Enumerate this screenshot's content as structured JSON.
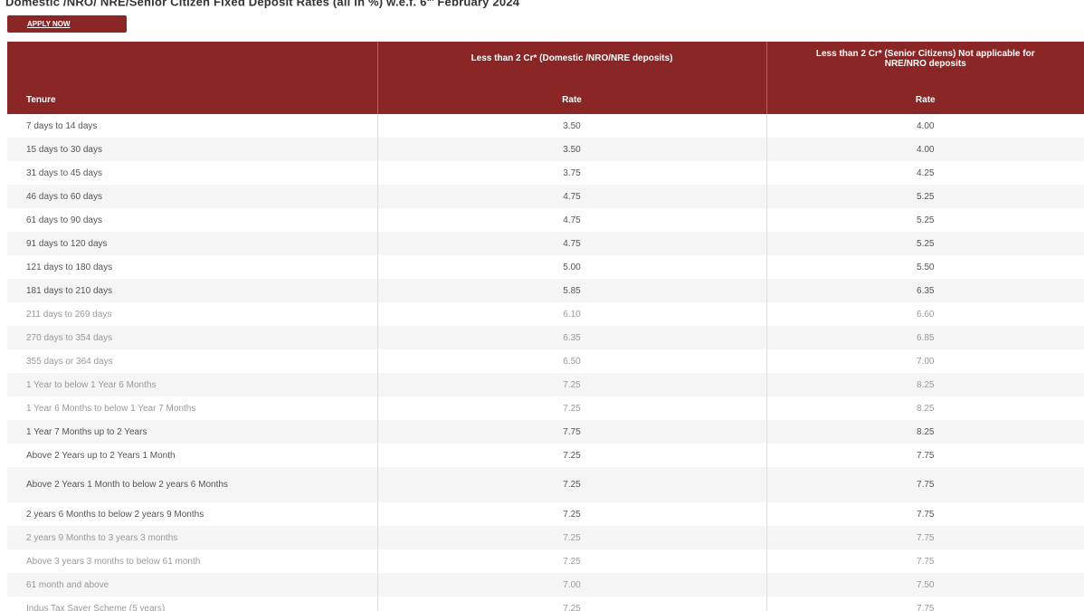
{
  "heading": {
    "prefix": "Domestic /NRO/ NRE/Senior Citizen Fixed Deposit Rates (all in %) w.e.f. 6",
    "sup": "th",
    "suffix": " February 2024"
  },
  "apply_button": {
    "label": "APPLY NOW"
  },
  "table": {
    "headers": {
      "tenure": "Tenure",
      "domestic_title": "Less than 2 Cr* (Domestic /NRO/NRE deposits)",
      "domestic_rate": "Rate",
      "senior_title": "Less than 2 Cr* (Senior Citizens) Not applicable for NRE/NRO deposits",
      "senior_rate": "Rate"
    },
    "rows": [
      {
        "tenure": "7 days to 14 days",
        "domestic": "3.50",
        "senior": "4.00"
      },
      {
        "tenure": "15 days to 30 days",
        "domestic": "3.50",
        "senior": "4.00"
      },
      {
        "tenure": "31 days to 45 days",
        "domestic": "3.75",
        "senior": "4.25"
      },
      {
        "tenure": "46 days to 60 days",
        "domestic": "4.75",
        "senior": "5.25"
      },
      {
        "tenure": "61 days to 90 days",
        "domestic": "4.75",
        "senior": "5.25"
      },
      {
        "tenure": "91 days to 120 days",
        "domestic": "4.75",
        "senior": "5.25"
      },
      {
        "tenure": "121 days to 180 days",
        "domestic": "5.00",
        "senior": "5.50"
      },
      {
        "tenure": "181 days to 210 days",
        "domestic": "5.85",
        "senior": "6.35"
      },
      {
        "tenure": "211 days to 269 days",
        "domestic": "6.10",
        "senior": "6.60"
      },
      {
        "tenure": "270 days to 354 days",
        "domestic": "6.35",
        "senior": "6.85"
      },
      {
        "tenure": "355 days or 364 days",
        "domestic": "6.50",
        "senior": "7.00"
      },
      {
        "tenure": "1 Year to below 1 Year 6 Months",
        "domestic": "7.25",
        "senior": "8.25"
      },
      {
        "tenure": "1 Year 6 Months to below 1 Year 7 Months",
        "domestic": "7.25",
        "senior": "8.25"
      },
      {
        "tenure": "1 Year 7 Months up to 2 Years",
        "domestic": "7.75",
        "senior": "8.25"
      },
      {
        "tenure": "Above 2 Years up to 2 Years 1 Month",
        "domestic": "7.25",
        "senior": "7.75"
      },
      {
        "tenure": "Above 2 Years 1 Month to below 2 years 6 Months",
        "domestic": "7.25",
        "senior": "7.75"
      },
      {
        "tenure": "2 years 6 Months to below 2 years 9 Months",
        "domestic": "7.25",
        "senior": "7.75"
      },
      {
        "tenure": "2 years 9 Months to 3 years 3 months",
        "domestic": "7.25",
        "senior": "7.75"
      },
      {
        "tenure": "Above 3 years 3 months to below 61 month",
        "domestic": "7.25",
        "senior": "7.75"
      },
      {
        "tenure": "61 month and above",
        "domestic": "7.00",
        "senior": "7.50"
      },
      {
        "tenure": "Indus Tax Saver Scheme (5 years)",
        "domestic": "7.25",
        "senior": "7.75"
      }
    ]
  },
  "colors": {
    "header_bg": "#8b2626",
    "row_stripe": "#f5f5f5"
  }
}
